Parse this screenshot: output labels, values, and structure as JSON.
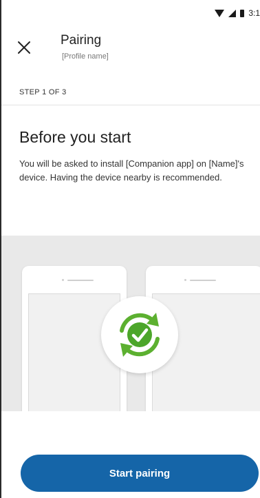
{
  "status_bar": {
    "time": "3:1",
    "icons": [
      "wifi-icon",
      "signal-icon",
      "battery-icon"
    ]
  },
  "app_bar": {
    "close_icon": "close-icon",
    "title": "Pairing",
    "subtitle": "[Profile name]"
  },
  "step": {
    "label": "STEP 1 OF 3"
  },
  "content": {
    "heading": "Before you start",
    "body": "You will be asked to install [Companion app] on [Name]'s device. Having the device nearby is recommended."
  },
  "illustration": {
    "icon": "sync-check-icon",
    "colors": {
      "background": "#e9e9e9",
      "arrows": "#5cb030",
      "check": "#4ca62a"
    }
  },
  "footer": {
    "primary_button_label": "Start pairing"
  },
  "colors": {
    "primary": "#1565a8",
    "text": "#222222",
    "muted": "#777777"
  }
}
